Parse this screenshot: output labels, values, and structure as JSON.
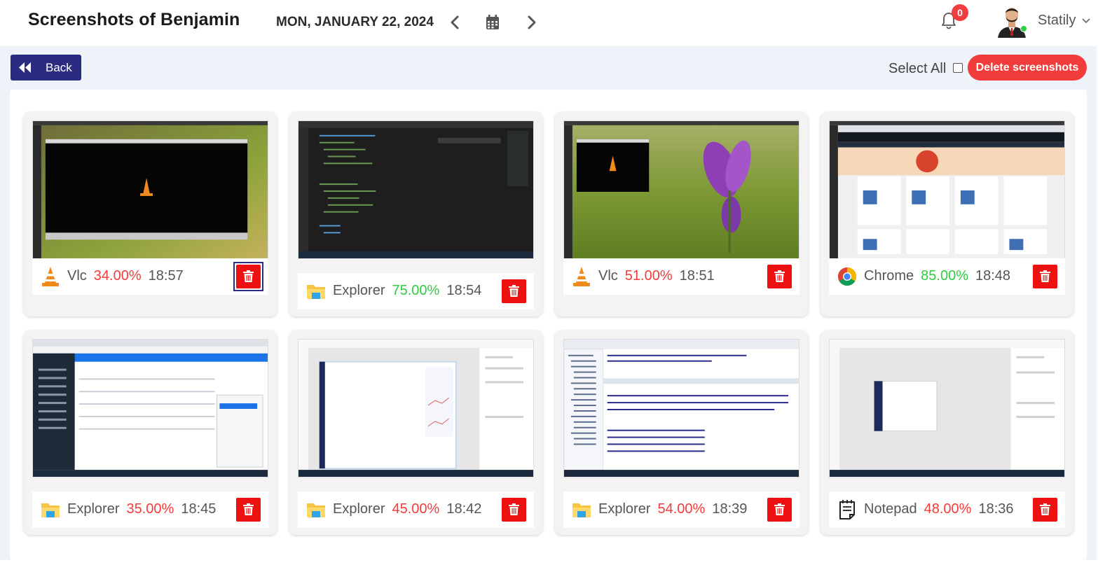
{
  "header": {
    "title": "Screenshots of Benjamin",
    "date": "MON, JANUARY 22, 2024",
    "notifications_count": "0",
    "user_name": "Statily"
  },
  "toolbar": {
    "back_label": "Back",
    "select_all_label": "Select All",
    "delete_label": "Delete screenshots"
  },
  "colors": {
    "accent": "#2c2b82",
    "danger": "#ee1111",
    "low": "#f23b3b",
    "high": "#2ecc40"
  },
  "cards": [
    {
      "app": "Vlc",
      "icon": "vlc-icon",
      "percent": "34.00%",
      "level": "low",
      "time": "18:57",
      "thumb": "vlc-desktop"
    },
    {
      "app": "Explorer",
      "icon": "explorer-folder-icon",
      "percent": "75.00%",
      "level": "high",
      "time": "18:54",
      "thumb": "code-editor"
    },
    {
      "app": "Vlc",
      "icon": "vlc-icon",
      "percent": "51.00%",
      "level": "low",
      "time": "18:51",
      "thumb": "vlc-flower"
    },
    {
      "app": "Chrome",
      "icon": "chrome-icon",
      "percent": "85.00%",
      "level": "high",
      "time": "18:48",
      "thumb": "shopping-site"
    },
    {
      "app": "Explorer",
      "icon": "explorer-folder-icon",
      "percent": "35.00%",
      "level": "low",
      "time": "18:45",
      "thumb": "web-app"
    },
    {
      "app": "Explorer",
      "icon": "explorer-folder-icon",
      "percent": "45.00%",
      "level": "low",
      "time": "18:42",
      "thumb": "design-tool"
    },
    {
      "app": "Explorer",
      "icon": "explorer-folder-icon",
      "percent": "54.00%",
      "level": "low",
      "time": "18:39",
      "thumb": "ide"
    },
    {
      "app": "Notepad",
      "icon": "notepad-icon",
      "percent": "48.00%",
      "level": "low",
      "time": "18:36",
      "thumb": "design-tool-2"
    }
  ]
}
